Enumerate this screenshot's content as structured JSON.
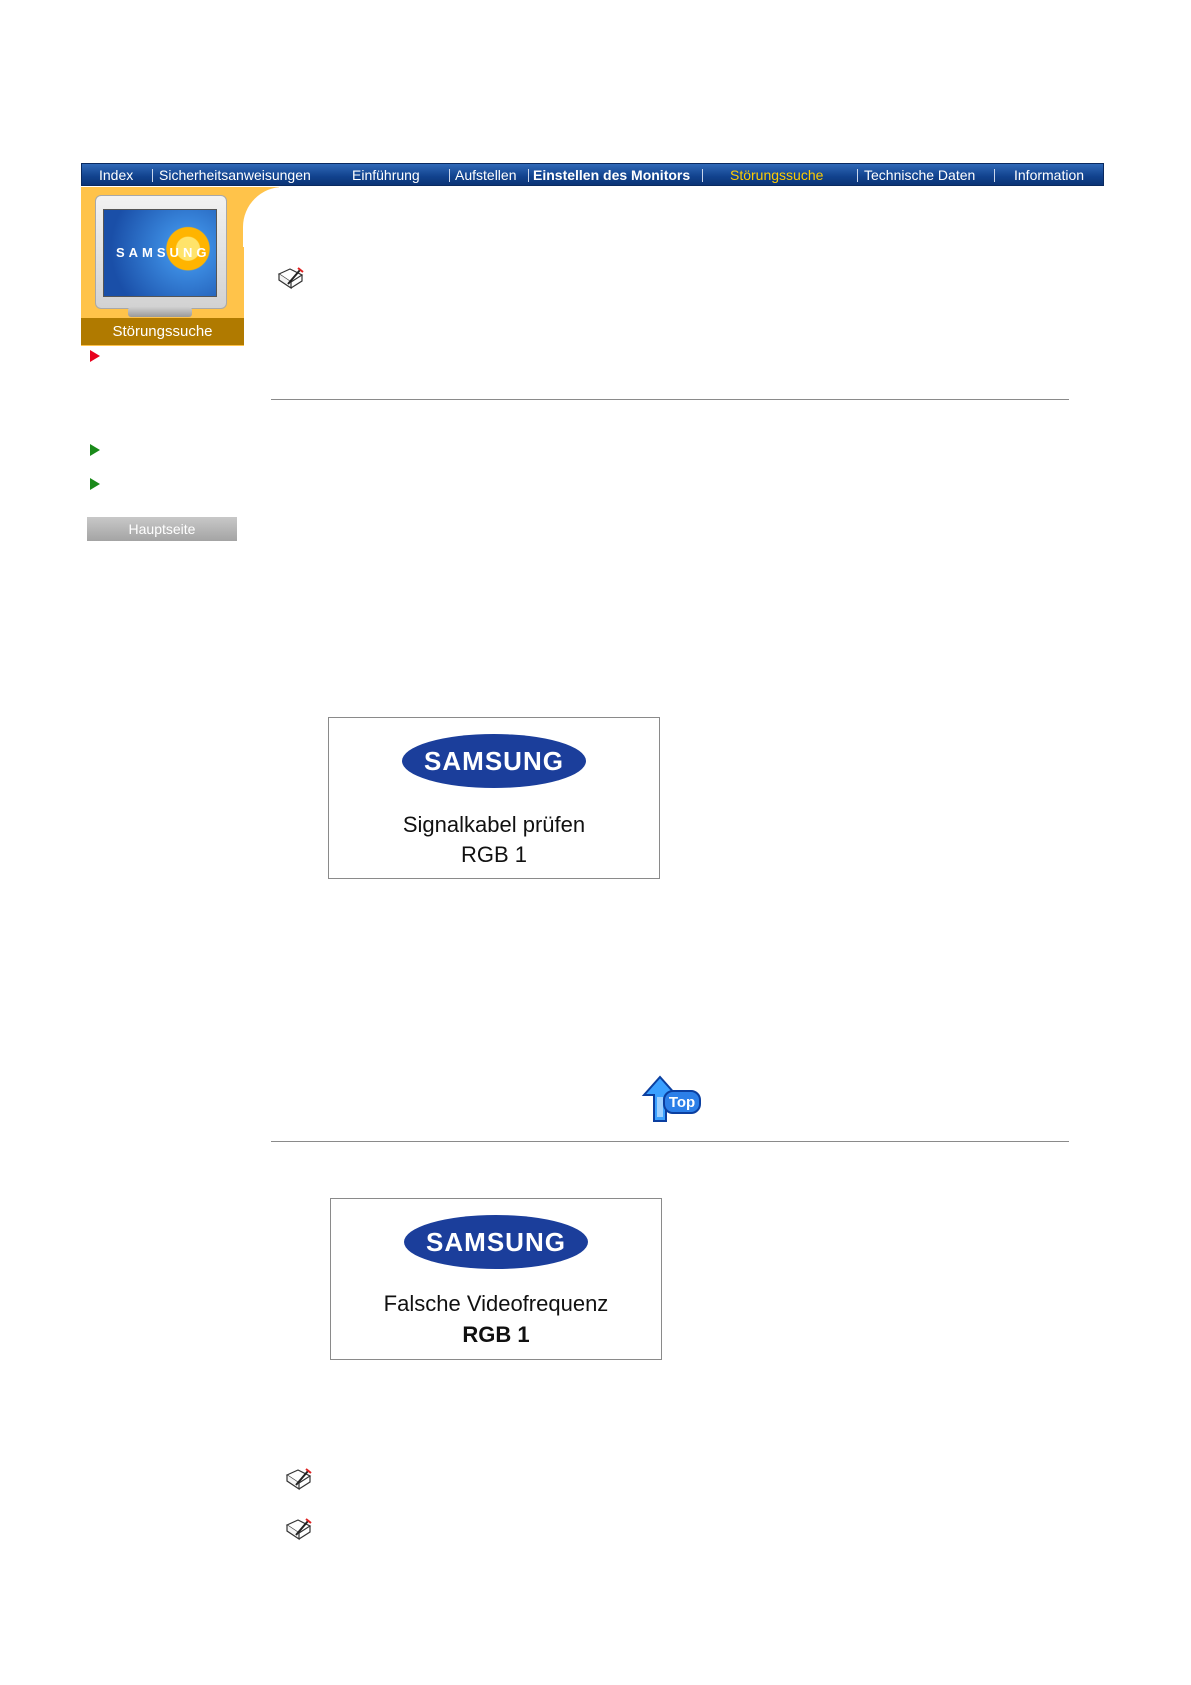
{
  "navigation": {
    "items": [
      {
        "label": "Index",
        "active": false,
        "bold": false
      },
      {
        "label": "Sicherheitsanweisungen",
        "active": false,
        "bold": false
      },
      {
        "label": "Einführung",
        "active": false,
        "bold": false
      },
      {
        "label": "Aufstellen",
        "active": false,
        "bold": false
      },
      {
        "label": "Einstellen des Monitors",
        "active": false,
        "bold": true
      },
      {
        "label": "Störungssuche",
        "active": true,
        "bold": false
      },
      {
        "label": "Technische Daten",
        "active": false,
        "bold": false
      },
      {
        "label": "Information",
        "active": false,
        "bold": false
      }
    ],
    "active_color": "#ffcc00"
  },
  "sidebar": {
    "banner_brand": "SAMSUNG",
    "banner_label": "Störungssuche",
    "home_button": "Hauptseite"
  },
  "content": {
    "osd_message_1": {
      "logo": "SAMSUNG",
      "line1": "Signalkabel prüfen",
      "line2": "RGB 1"
    },
    "osd_message_2": {
      "logo": "SAMSUNG",
      "line1": "Falsche Videofrequenz",
      "line2": "RGB 1"
    },
    "top_button_label": "Top"
  },
  "colors": {
    "nav_bar": "#11428d",
    "banner": "#ffc34a",
    "banner_label": "#b07a00",
    "samsung_blue": "#1b3e9b",
    "arrow_green": "#1a8a1a",
    "arrow_red": "#e8001c"
  }
}
